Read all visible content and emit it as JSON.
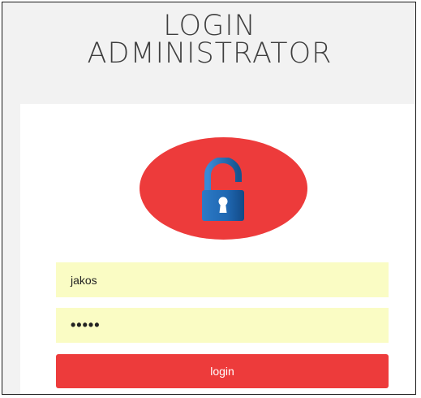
{
  "header": {
    "title_line1": "LOGIN",
    "title_line2": "ADMINISTRATOR"
  },
  "lock": {
    "icon": "padlock-open-icon",
    "circle_color": "#ed3b3b",
    "lock_color": "#1f67b1"
  },
  "form": {
    "username_value": "jakos",
    "password_value": "•••••",
    "field_background": "#fafcc4",
    "login_label": "login",
    "button_color": "#ed3b3b"
  }
}
